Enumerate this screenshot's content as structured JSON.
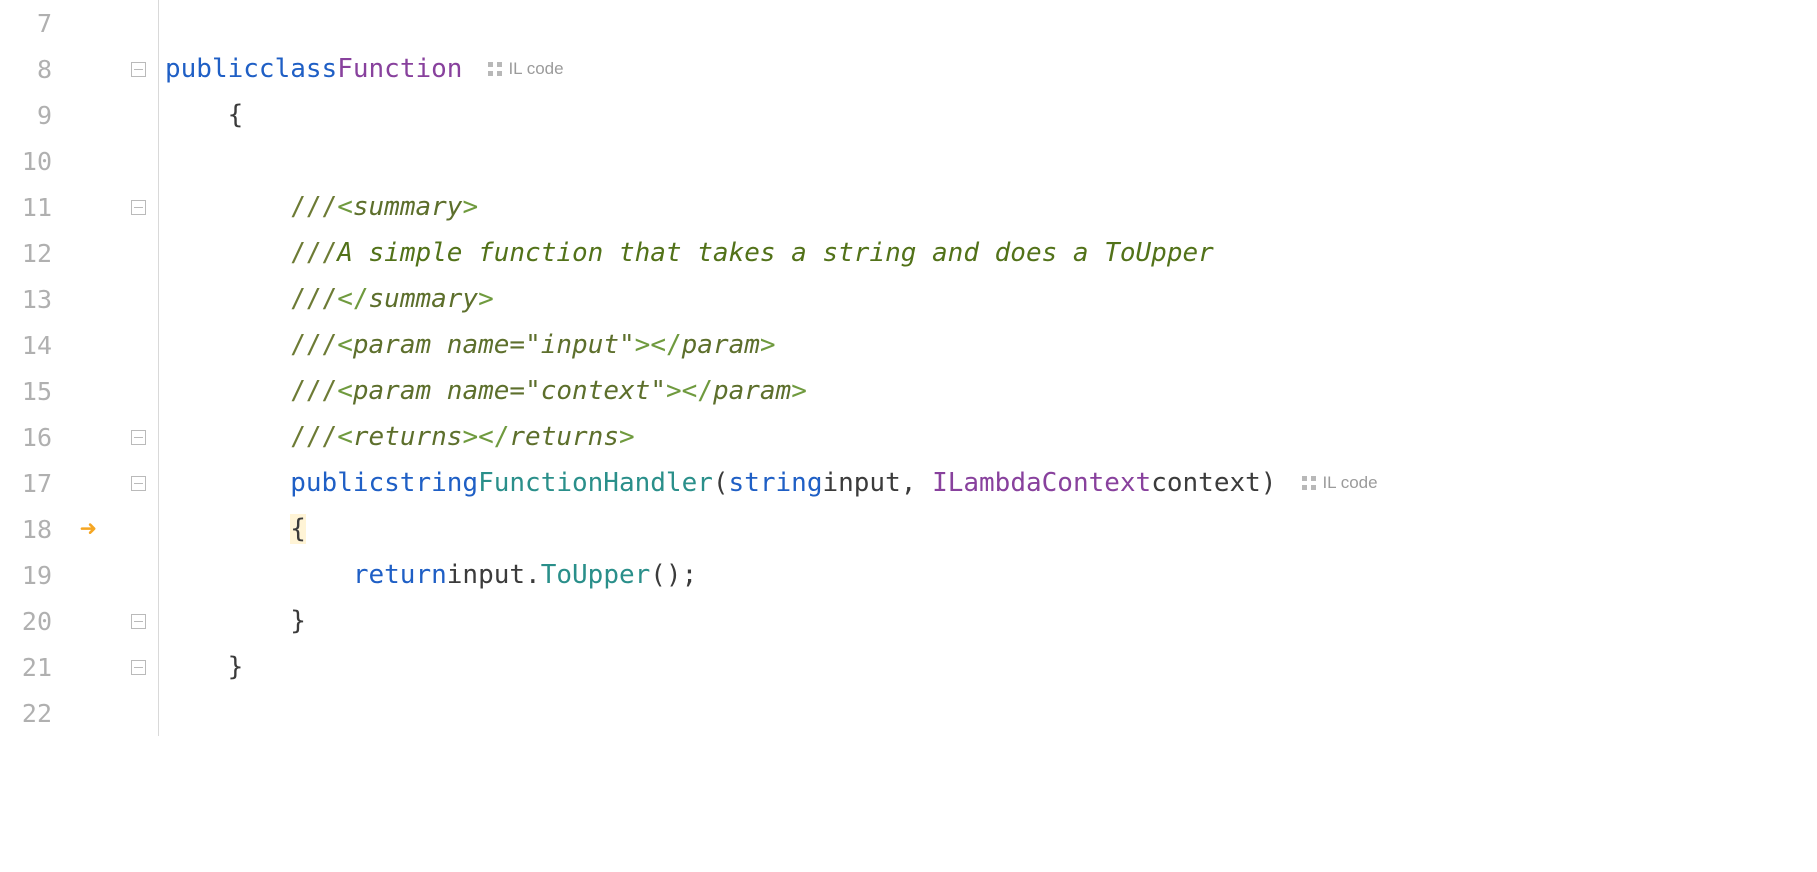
{
  "gutter": {
    "linenums": [
      "7",
      "8",
      "9",
      "10",
      "11",
      "12",
      "13",
      "14",
      "15",
      "16",
      "17",
      "18",
      "19",
      "20",
      "21",
      "22"
    ]
  },
  "il": {
    "label": "IL code"
  },
  "code": {
    "kw_public": "public",
    "kw_class": "class",
    "classname": "Function",
    "brace_open": "{",
    "brace_close": "}",
    "dslash": "///",
    "lt": "<",
    "gt": ">",
    "slash": "/",
    "tag_summary": "summary",
    "tag_param": "param",
    "tag_returns": "returns",
    "attr_name": "name",
    "eq": "=",
    "q": "\"",
    "param_input": "input",
    "param_context": "context",
    "doc_line": "A simple function that takes a string and does a ToUpper",
    "ret_type": "string",
    "method_name": "FunctionHandler",
    "arg_t1": "string",
    "arg_n1": "input",
    "arg_t2": "ILambdaContext",
    "arg_n2": "context",
    "paren_open": "(",
    "paren_close": ")",
    "comma_sp": ", ",
    "kw_return": "return",
    "expr_obj": "input",
    "dot": ".",
    "expr_call": "ToUpper",
    "call_parens": "()",
    "semi": ";",
    "indent1": "    ",
    "indent2": "        ",
    "indent3": "            "
  }
}
